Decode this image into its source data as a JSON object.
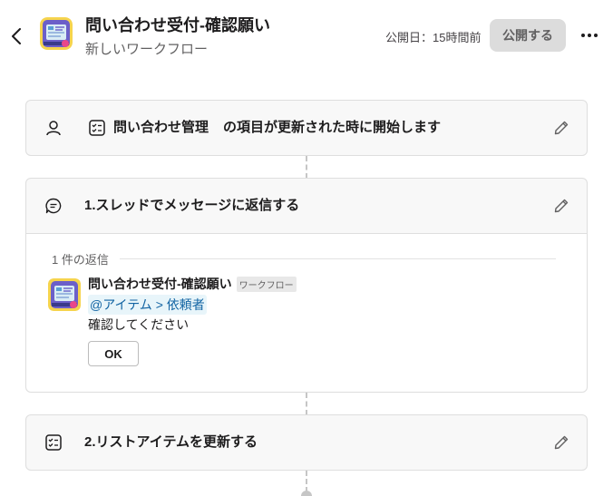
{
  "header": {
    "title": "問い合わせ受付-確認願い",
    "subtitle": "新しいワークフロー",
    "published_label": "公開日：15時間前",
    "publish_button": "公開する"
  },
  "trigger": {
    "list_name": "問い合わせ管理",
    "text": "の項目が更新された時に開始します"
  },
  "steps": [
    {
      "title": "1.スレッドでメッセージに返信する",
      "reply_count": "1 件の返信",
      "message": {
        "sender": "問い合わせ受付-確認願い",
        "badge": "ワークフロー",
        "mention": "@アイテム > 依頼者",
        "text": "確認してください",
        "button": "OK"
      }
    },
    {
      "title": "2.リストアイテムを更新する"
    }
  ],
  "colors": {
    "mention": "#1264a3",
    "mention_bg": "#e8f5fa",
    "card_bg": "#f8f8f8",
    "border": "#dedede"
  }
}
